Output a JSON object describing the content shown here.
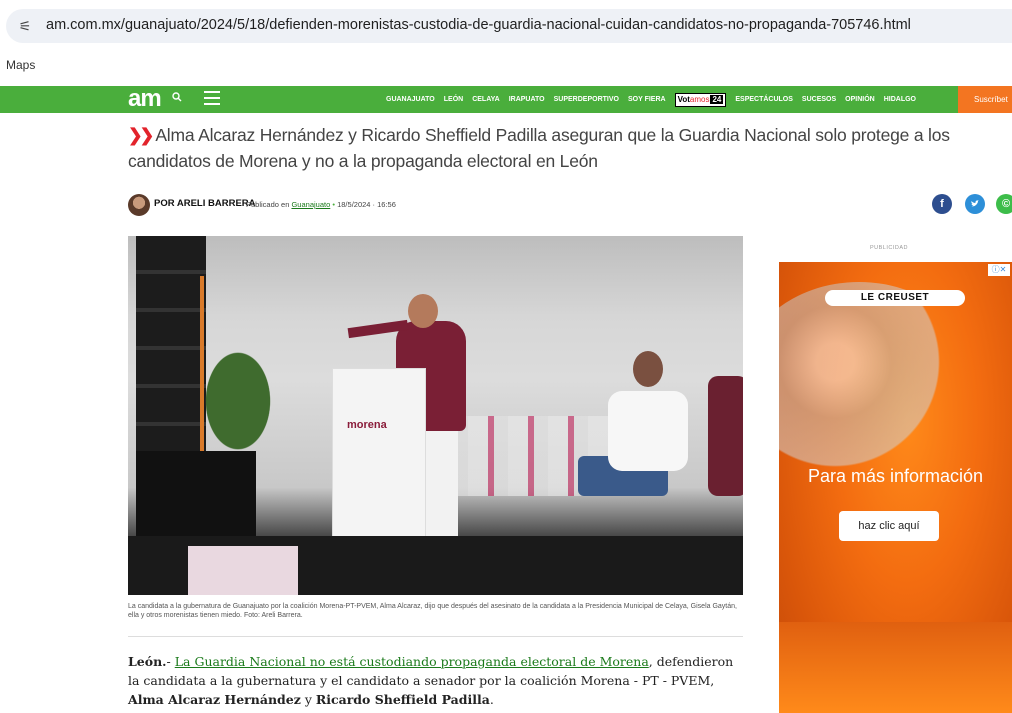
{
  "browser": {
    "url": "am.com.mx/guanajuato/2024/5/18/defienden-morenistas-custodia-de-guardia-nacional-cuidan-candidatos-no-propaganda-705746.html",
    "bookmark_1": "Maps"
  },
  "site": {
    "logo": "am",
    "nav": [
      "GUANAJUATO",
      "LEÓN",
      "CELAYA",
      "IRAPUATO",
      "SUPERDEPORTIVO",
      "SOY FIERA"
    ],
    "votamos": {
      "a": "Vot",
      "b": "amos",
      "c": "24"
    },
    "nav2": [
      "ESPECTÁCULOS",
      "SUCESOS",
      "OPINIÓN",
      "HIDALGO"
    ],
    "subscribe": "Suscríbet"
  },
  "article": {
    "headline": "Alma Alcaraz Hernández y Ricardo Sheffield Padilla aseguran que la Guardia Nacional solo protege a los candidatos de Morena y no a la propaganda electoral en León",
    "byline": "POR ARELI BARRERA",
    "published_prefix": "Publicado en",
    "category": "Guanajuato",
    "date": "18/5/2024 · 16:56",
    "photo_podium_text": "morena",
    "caption": "La candidata a la gubernatura de Guanajuato por la coalición Morena-PT-PVEM, Alma Alcaraz, dijo que después del asesinato de la candidata a la Presidencia Municipal de Celaya, Gisela Gaytán, ella y otros morenistas tienen miedo. Foto: Areli Barrera.",
    "body_city": "León.",
    "body_link": "La Guardia Nacional no está custodiando propaganda electoral de Morena",
    "body_mid": ", defendieron la candidata a la gubernatura y el candidato a senador por la coalición Morena - PT - PVEM,",
    "body_name1": "Alma Alcaraz Hernández",
    "body_and": "y",
    "body_name2": "Ricardo Sheffield Padilla",
    "body_end": "."
  },
  "ad": {
    "label": "PUBLICIDAD",
    "brand": "LE CREUSET",
    "headline": "Para más información",
    "button": "haz clic aquí"
  },
  "colors": {
    "nav_green": "#4aae3c",
    "accent_red": "#e2232b",
    "subscribe_orange": "#f37521"
  },
  "icons": [
    "site-info-icon",
    "search-icon",
    "menu-icon",
    "facebook-icon",
    "twitter-icon",
    "whatsapp-icon",
    "adchoices-icon"
  ]
}
